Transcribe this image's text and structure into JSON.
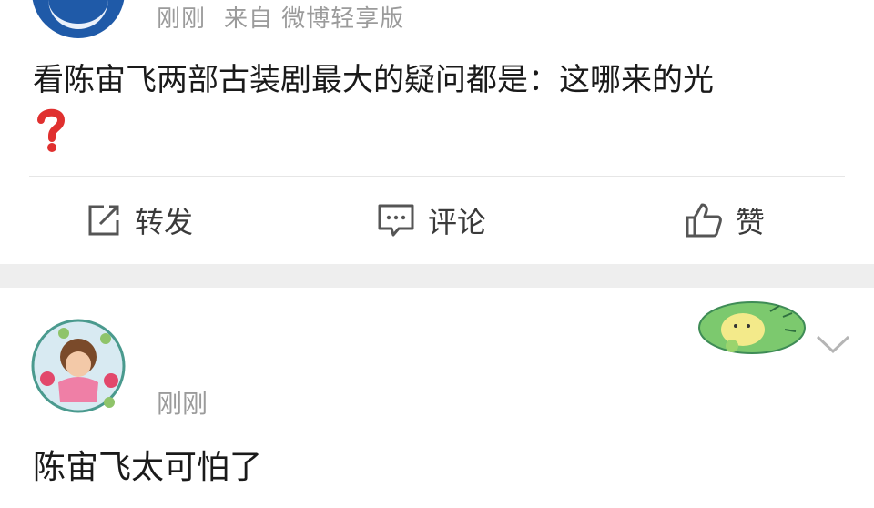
{
  "post": {
    "meta": {
      "time": "刚刚",
      "source": "来自 微博轻享版"
    },
    "text": "看陈宙飞两部古装剧最大的疑问都是：这哪来的光",
    "emoji_icon": "red-question-mark-icon"
  },
  "actions": {
    "repost_label": "转发",
    "comment_label": "评论",
    "like_label": "赞"
  },
  "comment": {
    "time": "刚刚",
    "text": "陈宙飞太可怕了"
  },
  "colors": {
    "text": "#1a1a1a",
    "meta": "#9b9b9b",
    "divider": "#e6e6e6",
    "gap": "#eeeeee",
    "avatar_blue": "#1f5aa8",
    "question_red": "#e0302f"
  }
}
